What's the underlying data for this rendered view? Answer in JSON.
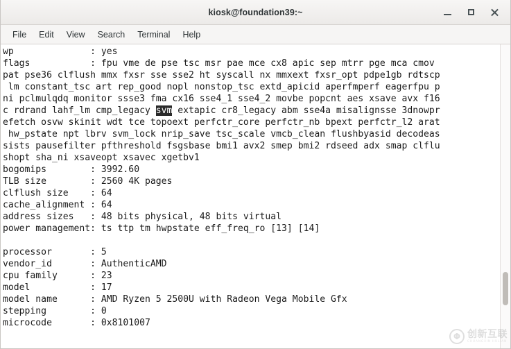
{
  "window": {
    "title": "kiosk@foundation39:~",
    "controls": [
      {
        "name": "minimize",
        "label": "–"
      },
      {
        "name": "maximize",
        "label": "□"
      },
      {
        "name": "close",
        "label": "✕"
      }
    ]
  },
  "menubar": {
    "items": [
      {
        "label": "File"
      },
      {
        "label": "Edit"
      },
      {
        "label": "View"
      },
      {
        "label": "Search"
      },
      {
        "label": "Terminal"
      },
      {
        "label": "Help"
      }
    ]
  },
  "terminal": {
    "highlight_term": "svm",
    "lines": [
      {
        "text": "wp              : yes"
      },
      {
        "text": "flags           : fpu vme de pse tsc msr pae mce cx8 apic sep mtrr pge mca cmov"
      },
      {
        "text": "pat pse36 clflush mmx fxsr sse sse2 ht syscall nx mmxext fxsr_opt pdpe1gb rdtscp"
      },
      {
        "text": " lm constant_tsc art rep_good nopl nonstop_tsc extd_apicid aperfmperf eagerfpu p"
      },
      {
        "text": "ni pclmulqdq monitor ssse3 fma cx16 sse4_1 sse4_2 movbe popcnt aes xsave avx f16"
      },
      {
        "pre": "c rdrand lahf_lm cmp_legacy ",
        "mark": "svm",
        "post": " extapic cr8_legacy abm sse4a misalignsse 3dnowpr"
      },
      {
        "text": "efetch osvw skinit wdt tce topoext perfctr_core perfctr_nb bpext perfctr_l2 arat"
      },
      {
        "text": " hw_pstate npt lbrv svm_lock nrip_save tsc_scale vmcb_clean flushbyasid decodeas"
      },
      {
        "text": "sists pausefilter pfthreshold fsgsbase bmi1 avx2 smep bmi2 rdseed adx smap clflu"
      },
      {
        "text": "shopt sha_ni xsaveopt xsavec xgetbv1"
      },
      {
        "text": "bogomips        : 3992.60"
      },
      {
        "text": "TLB size        : 2560 4K pages"
      },
      {
        "text": "clflush size    : 64"
      },
      {
        "text": "cache_alignment : 64"
      },
      {
        "text": "address sizes   : 48 bits physical, 48 bits virtual"
      },
      {
        "text": "power management: ts ttp tm hwpstate eff_freq_ro [13] [14]"
      },
      {
        "text": ""
      },
      {
        "text": "processor       : 5"
      },
      {
        "text": "vendor_id       : AuthenticAMD"
      },
      {
        "text": "cpu family      : 23"
      },
      {
        "text": "model           : 17"
      },
      {
        "text": "model name      : AMD Ryzen 5 2500U with Radeon Vega Mobile Gfx"
      },
      {
        "text": "stepping        : 0"
      },
      {
        "text": "microcode       : 0x8101007"
      }
    ]
  },
  "watermark": {
    "logo_glyph": "Φ",
    "chinese": "创新互联",
    "pinyin": "CHUANGXIN HULIAN"
  },
  "colors": {
    "titlebar_bg": "#f0eeec",
    "terminal_bg": "#ffffff",
    "terminal_fg": "#1a1a1a",
    "highlight_bg": "#2a2a2a",
    "highlight_fg": "#ffffff",
    "scrollbar_thumb": "#c0bcb8"
  }
}
